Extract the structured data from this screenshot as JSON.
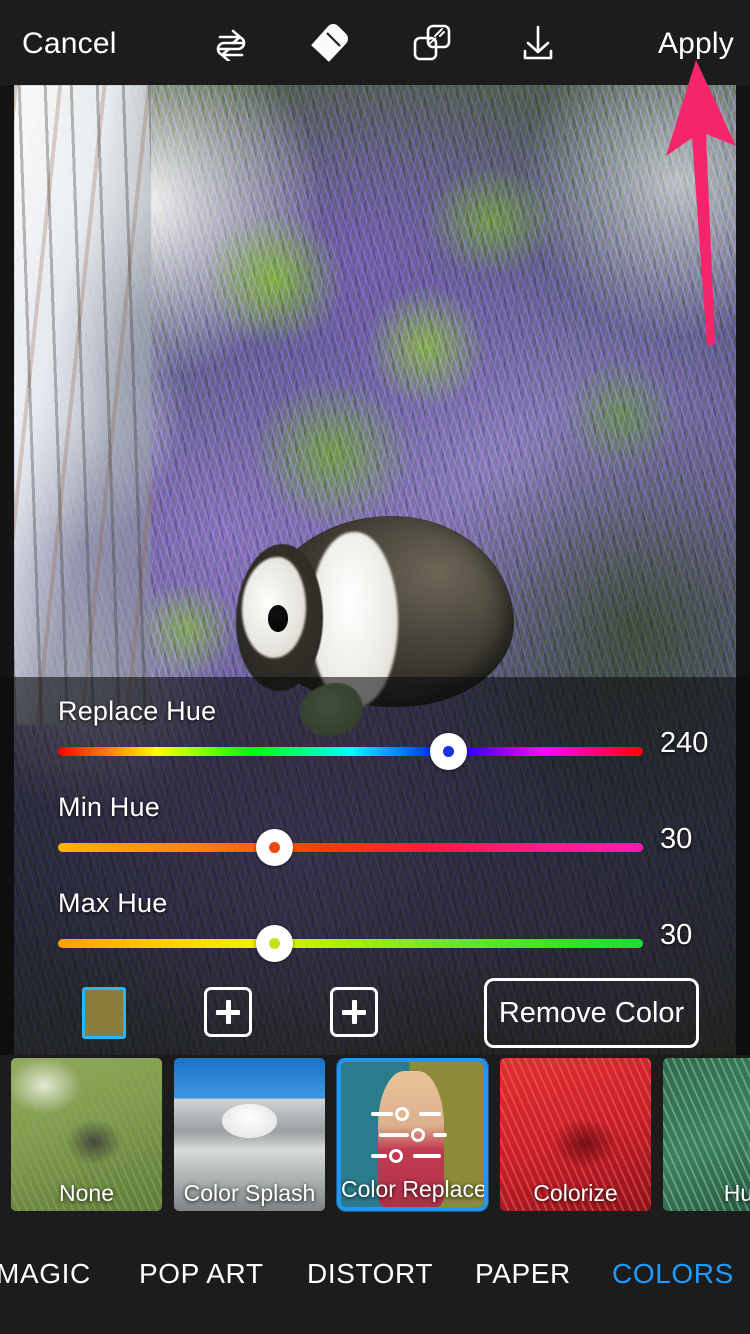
{
  "topbar": {
    "cancel_label": "Cancel",
    "apply_label": "Apply",
    "icons": [
      {
        "name": "redo-icon",
        "title": "Redo"
      },
      {
        "name": "eraser-icon",
        "title": "Eraser"
      },
      {
        "name": "mask-icon",
        "title": "Mask"
      },
      {
        "name": "save-icon",
        "title": "Save"
      }
    ]
  },
  "annotation": {
    "arrow_color": "#f5256b",
    "points_to": "Apply"
  },
  "controls": {
    "sliders": [
      {
        "label": "Replace Hue",
        "value": "240",
        "percent": 66.7,
        "gradient": "hue-full",
        "dot_color": "#1830e0"
      },
      {
        "label": "Min Hue",
        "value": "30",
        "percent": 37.0,
        "gradient": "orange-magenta",
        "dot_color": "#f04a0a"
      },
      {
        "label": "Max Hue",
        "value": "30",
        "percent": 37.0,
        "gradient": "orange-green",
        "dot_color": "#c8e018"
      }
    ],
    "color_swatch": {
      "color": "#8b7b3d",
      "border_color": "#29b6f6"
    },
    "add_button_label": "+",
    "remove_color_label": "Remove Color"
  },
  "filters": [
    {
      "label": "None",
      "art": "t-none",
      "selected": false,
      "has_slider_icon": false
    },
    {
      "label": "Color Splash",
      "art": "t-splash",
      "selected": false,
      "has_slider_icon": false
    },
    {
      "label": "Color Replace",
      "art": "t-replace",
      "selected": true,
      "has_slider_icon": true
    },
    {
      "label": "Colorize",
      "art": "t-colorize",
      "selected": false,
      "has_slider_icon": false
    },
    {
      "label": "Hu",
      "art": "t-hue",
      "selected": false,
      "has_slider_icon": false
    }
  ],
  "tabs": [
    {
      "label": "MAGIC",
      "active": false
    },
    {
      "label": "POP ART",
      "active": false
    },
    {
      "label": "DISTORT",
      "active": false
    },
    {
      "label": "PAPER",
      "active": false
    },
    {
      "label": "COLORS",
      "active": true
    }
  ],
  "theme": {
    "chrome_bg": "#1c1c1c",
    "accent": "#1f9bff",
    "selection_border": "#2196f3"
  }
}
